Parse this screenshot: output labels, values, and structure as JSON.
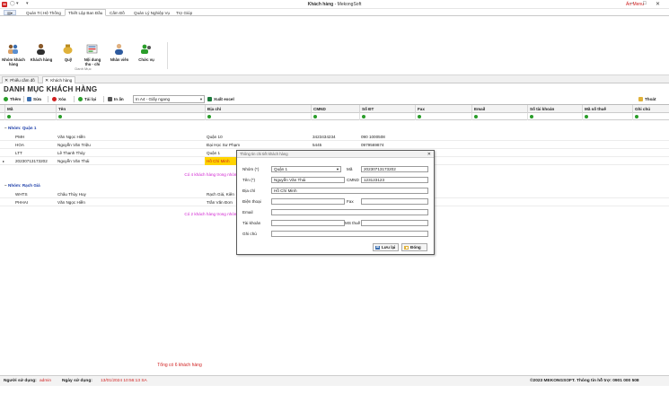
{
  "window": {
    "title_bold": "Khách hàng",
    "title_rest": " - MekongSoft",
    "hide_menu": "Ẩn Menu"
  },
  "ribbon": {
    "tabs": [
      "Quản Trị Hệ Thống",
      "Thiết Lập Ban Đầu",
      "Cấm Đồ",
      "Quản Lý Nghiệp Vụ",
      "Trợ Giúp"
    ],
    "active_tab": "Thiết Lập Ban Đầu",
    "buttons": [
      {
        "label_1": "Nhóm khách",
        "label_2": "hàng"
      },
      {
        "label_1": "Khách hàng",
        "label_2": ""
      },
      {
        "label_1": "Quỹ",
        "label_2": ""
      },
      {
        "label_1": "Nội dung",
        "label_2": "thu - chi"
      },
      {
        "label_1": "Nhân viên",
        "label_2": ""
      },
      {
        "label_1": "Chức vụ",
        "label_2": ""
      }
    ],
    "group_label": "Danh Mục"
  },
  "doc_tabs": [
    "Phiếu cầm đồ",
    "Khách hàng"
  ],
  "page": {
    "heading": "DANH MỤC KHÁCH HÀNG"
  },
  "toolbar": {
    "add": "Thêm",
    "edit": "Sửa",
    "delete": "Xóa",
    "reload": "Tải lại",
    "print": "In ấn",
    "paper": "In A4 - Giấy ngang",
    "export": "Xuất excel",
    "exit": "Thoát"
  },
  "grid": {
    "columns": [
      "Mã",
      "Tên",
      "Địa chỉ",
      "CMND",
      "Số ĐT",
      "Fax",
      "Email",
      "Số tài khoản",
      "Mã số thuế",
      "Ghi chú"
    ],
    "groups": [
      {
        "title": "Nhóm: Quận 1",
        "rows": [
          {
            "ma": "PMH",
            "ten": "Văn Ngọc Hiền",
            "dia_chi": "Quận 10",
            "cmnd": "3423434234",
            "sdt": "090 1000508"
          },
          {
            "ma": "HOA",
            "ten": "Nguyễn Văn Triệu",
            "dia_chi": "Đại Học Sư Phạm",
            "cmnd": "5445",
            "sdt": "0979569874"
          },
          {
            "ma": "LTT",
            "ten": "Lê Thanh Thủy",
            "dia_chi": "Quận 1",
            "cmnd": "",
            "sdt": ""
          },
          {
            "ma": "20230713173202",
            "ten": "Nguyễn Văn Thái",
            "dia_chi": "Hồ Chí Minh",
            "cmnd": "",
            "sdt": ""
          }
        ],
        "summary": "Có 4 khách hàng trong nhóm"
      },
      {
        "title": "Nhóm: Rạch Giá",
        "rows": [
          {
            "ma": "WHTS",
            "ten": "Châu Thùy Huy",
            "dia_chi": "Rạch Giá, Kiên",
            "cmnd": "",
            "sdt": ""
          },
          {
            "ma": "PHHAI",
            "ten": "Văn Ngọc Hiền",
            "dia_chi": "Trần Văn Đơn",
            "cmnd": "",
            "sdt": ""
          }
        ],
        "summary": "Có 2 khách hàng trong nhóm"
      }
    ],
    "total": "Tổng có 6 khách hàng"
  },
  "status": {
    "user_label": "Người sử dụng:",
    "user": "admin",
    "date_label": "Ngày sử dụng:",
    "date": "13/01/2024 10:56:13 SA",
    "copyright": "©2023 MEKONGSOFT. Thông tin hỗ trợ: 0901 000 508"
  },
  "dialog": {
    "title": "Thông tin chi tiết khách hàng",
    "labels": {
      "nhom": "Nhóm (*)",
      "ma": "Mã",
      "ten": "Tên (*)",
      "cmnd": "CMND",
      "dia_chi": "Địa chỉ",
      "dien_thoai": "Điện thoại",
      "fax": "Fax",
      "email": "Email",
      "tai_khoan": "Tài khoản",
      "ms_thue": "MS thuế",
      "ghi_chu": "Ghi chú"
    },
    "values": {
      "nhom": "Quận 1",
      "ma": "20230713173202",
      "ten": "Nguyễn Văn Thái",
      "cmnd": "123123123",
      "dia_chi": "Hồ Chí Minh",
      "dien_thoai": "",
      "fax": "",
      "email": "",
      "tai_khoan": "",
      "ms_thue": "",
      "ghi_chu": ""
    },
    "save": "Lưu lại",
    "close": "Đóng"
  },
  "colors": {
    "accent_red": "#d01f1f",
    "group_blue": "#1a3ca8",
    "summary_magenta": "#d01fd0",
    "highlight": "#ffd400"
  }
}
